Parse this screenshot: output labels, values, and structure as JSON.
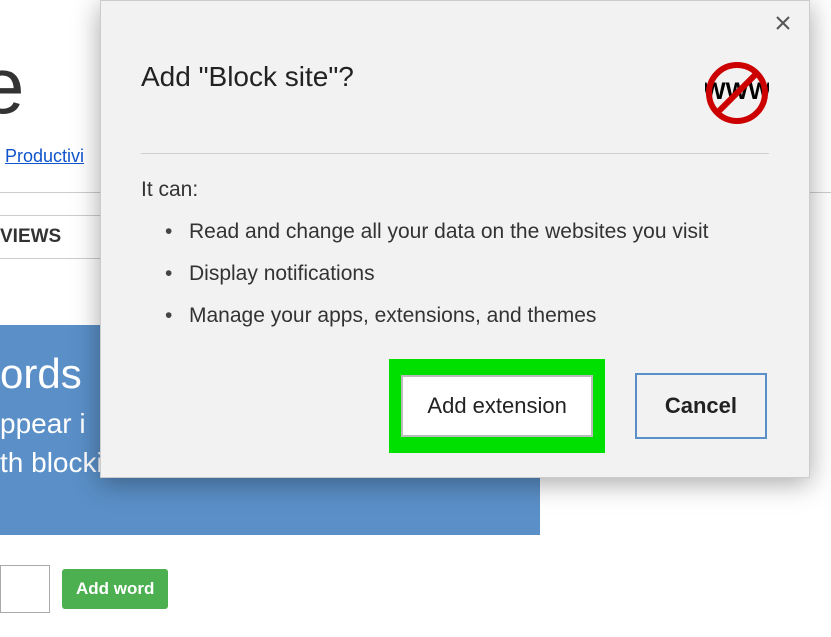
{
  "background": {
    "partial_title_letter": "e",
    "productivity_link": "Productivi",
    "tab_views": "VIEWS",
    "blue_panel": {
      "line1": "ords",
      "line2": "ppear i",
      "line3": "th blocking search queries."
    },
    "add_word_button": "Add word"
  },
  "dialog": {
    "title": "Add \"Block site\"?",
    "icon_text": "WWW",
    "it_can_label": "It can:",
    "permissions": [
      "Read and change all your data on the websites you visit",
      "Display notifications",
      "Manage your apps, extensions, and themes"
    ],
    "add_button": "Add extension",
    "cancel_button": "Cancel"
  }
}
